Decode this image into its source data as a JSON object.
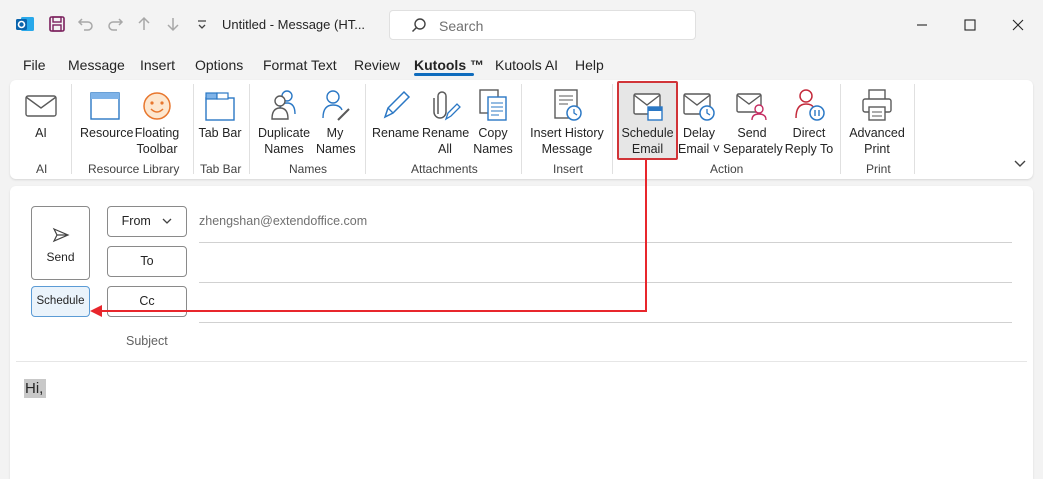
{
  "titlebar": {
    "title": "Untitled  -  Message (HT...",
    "search_placeholder": "Search"
  },
  "menu": {
    "items": [
      "File",
      "Message",
      "Insert",
      "Options",
      "Format Text",
      "Review",
      "Kutools ™",
      "Kutools AI",
      "Help"
    ],
    "active": "Kutools ™"
  },
  "ribbon": {
    "buttons": {
      "ai": "AI",
      "resource": "Resource",
      "floating_toolbar": [
        "Floating",
        "Toolbar"
      ],
      "tab_bar": "Tab Bar",
      "duplicate_names": [
        "Duplicate",
        "Names"
      ],
      "my_names": [
        "My",
        "Names"
      ],
      "rename": "Rename",
      "rename_all": [
        "Rename",
        "All"
      ],
      "copy_names": [
        "Copy",
        "Names"
      ],
      "insert_history": [
        "Insert History",
        "Message"
      ],
      "schedule_email": [
        "Schedule",
        "Email"
      ],
      "delay_email": [
        "Delay",
        "Email ˅"
      ],
      "send_separately": [
        "Send",
        "Separately"
      ],
      "direct_reply": [
        "Direct",
        "Reply To"
      ],
      "advanced_print": [
        "Advanced",
        "Print"
      ]
    },
    "groups": {
      "ai": "AI",
      "resource_library": "Resource Library",
      "tab_bar": "Tab Bar",
      "names": "Names",
      "attachments": "Attachments",
      "insert": "Insert",
      "action": "Action",
      "print": "Print"
    }
  },
  "compose": {
    "send_label": "Send",
    "schedule_label": "Schedule",
    "from_label": "From",
    "to_label": "To",
    "cc_label": "Cc",
    "from_email": "zhengshan@extendoffice.com",
    "subject_label": "Subject",
    "body_text": "Hi,"
  },
  "colors": {
    "accent": "#0f6cbd",
    "annotation_red": "#d13438",
    "outlook_blue": "#0078d4"
  }
}
